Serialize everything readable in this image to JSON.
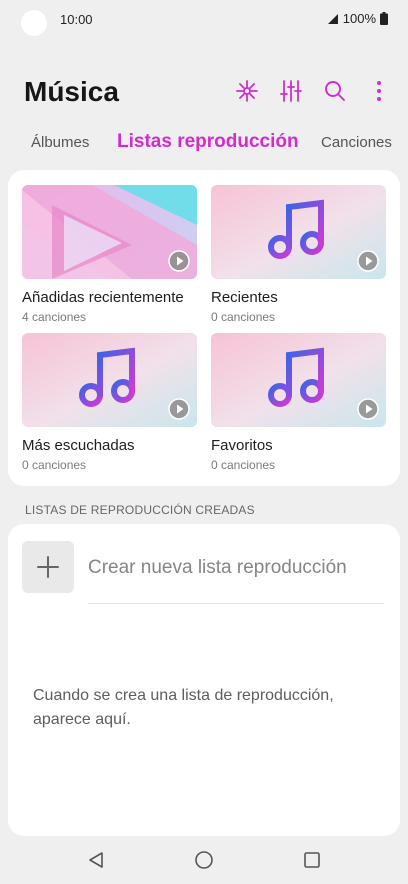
{
  "status": {
    "time": "10:00",
    "battery": "100%"
  },
  "header": {
    "title": "Música"
  },
  "icons": {
    "visualizer": "visualizer-icon",
    "equalizer": "equalizer-icon",
    "search": "search-icon",
    "more": "more-vertical-icon"
  },
  "tabs": [
    {
      "label": "Álbumes",
      "active": false
    },
    {
      "label": "Listas reproducción",
      "active": true
    },
    {
      "label": "Canciones",
      "active": false
    }
  ],
  "playlists": [
    {
      "title": "Añadidas recientemente",
      "count": "4 canciones"
    },
    {
      "title": "Recientes",
      "count": "0 canciones"
    },
    {
      "title": "Más escuchadas",
      "count": "0 canciones"
    },
    {
      "title": "Favoritos",
      "count": "0 canciones"
    }
  ],
  "created": {
    "section_label": "LISTAS DE REPRODUCCIÓN CREADAS",
    "create_label": "Crear nueva lista reproducción",
    "empty_message": "Cuando se crea una lista de reproducción, aparece aquí."
  },
  "colors": {
    "accent": "#d22ccf",
    "background": "#efefef"
  }
}
